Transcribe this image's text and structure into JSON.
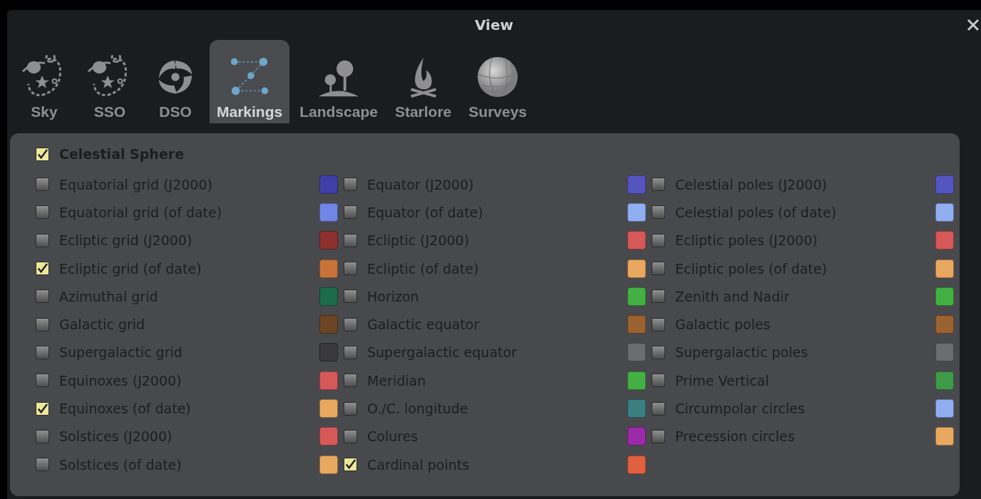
{
  "window": {
    "title": "View"
  },
  "tabs": [
    {
      "label": "Sky",
      "selected": false
    },
    {
      "label": "SSO",
      "selected": false
    },
    {
      "label": "DSO",
      "selected": false
    },
    {
      "label": "Markings",
      "selected": true
    },
    {
      "label": "Landscape",
      "selected": false
    },
    {
      "label": "Starlore",
      "selected": false
    },
    {
      "label": "Surveys",
      "selected": false
    }
  ],
  "group": {
    "label": "Celestial Sphere",
    "checked": true
  },
  "columns": [
    [
      {
        "label": "Equatorial grid (J2000)",
        "checked": false,
        "color": "#3f3fa8"
      },
      {
        "label": "Equatorial grid (of date)",
        "checked": false,
        "color": "#6f86e6"
      },
      {
        "label": "Ecliptic grid (J2000)",
        "checked": false,
        "color": "#8e3030"
      },
      {
        "label": "Ecliptic grid (of date)",
        "checked": true,
        "color": "#c8733a"
      },
      {
        "label": "Azimuthal grid",
        "checked": false,
        "color": "#1c6b4a"
      },
      {
        "label": "Galactic grid",
        "checked": false,
        "color": "#6b4524"
      },
      {
        "label": "Supergalactic grid",
        "checked": false,
        "color": "#3a3a3c"
      },
      {
        "label": "Equinoxes (J2000)",
        "checked": false,
        "color": "#d65858"
      },
      {
        "label": "Equinoxes (of date)",
        "checked": true,
        "color": "#e8a860"
      },
      {
        "label": "Solstices (J2000)",
        "checked": false,
        "color": "#d65858"
      },
      {
        "label": "Solstices (of date)",
        "checked": false,
        "color": "#e8a860"
      }
    ],
    [
      {
        "label": "Equator (J2000)",
        "checked": false,
        "color": "#5555c0"
      },
      {
        "label": "Equator (of date)",
        "checked": false,
        "color": "#90aef0"
      },
      {
        "label": "Ecliptic (J2000)",
        "checked": false,
        "color": "#d65858"
      },
      {
        "label": "Ecliptic (of date)",
        "checked": false,
        "color": "#e8a860"
      },
      {
        "label": "Horizon",
        "checked": false,
        "color": "#44b044"
      },
      {
        "label": "Galactic equator",
        "checked": false,
        "color": "#9a6230"
      },
      {
        "label": "Supergalactic equator",
        "checked": false,
        "color": "#6c6c6e"
      },
      {
        "label": "Meridian",
        "checked": false,
        "color": "#44b044"
      },
      {
        "label": "O./C. longitude",
        "checked": false,
        "color": "#3a8080"
      },
      {
        "label": "Colures",
        "checked": false,
        "color": "#9a2aa8"
      },
      {
        "label": "Cardinal points",
        "checked": true,
        "color": "#e06040"
      }
    ],
    [
      {
        "label": "Celestial poles (J2000)",
        "checked": false,
        "color": "#5555c0"
      },
      {
        "label": "Celestial poles (of date)",
        "checked": false,
        "color": "#90aef0"
      },
      {
        "label": "Ecliptic poles (J2000)",
        "checked": false,
        "color": "#d65858"
      },
      {
        "label": "Ecliptic poles (of date)",
        "checked": false,
        "color": "#e8a860"
      },
      {
        "label": "Zenith and Nadir",
        "checked": false,
        "color": "#44b044"
      },
      {
        "label": "Galactic poles",
        "checked": false,
        "color": "#9a6230"
      },
      {
        "label": "Supergalactic poles",
        "checked": false,
        "color": "#6c6c6e"
      },
      {
        "label": "Prime Vertical",
        "checked": false,
        "color": "#3e9a48"
      },
      {
        "label": "Circumpolar circles",
        "checked": false,
        "color": "#90aef0"
      },
      {
        "label": "Precession circles",
        "checked": false,
        "color": "#e8a860"
      }
    ]
  ]
}
